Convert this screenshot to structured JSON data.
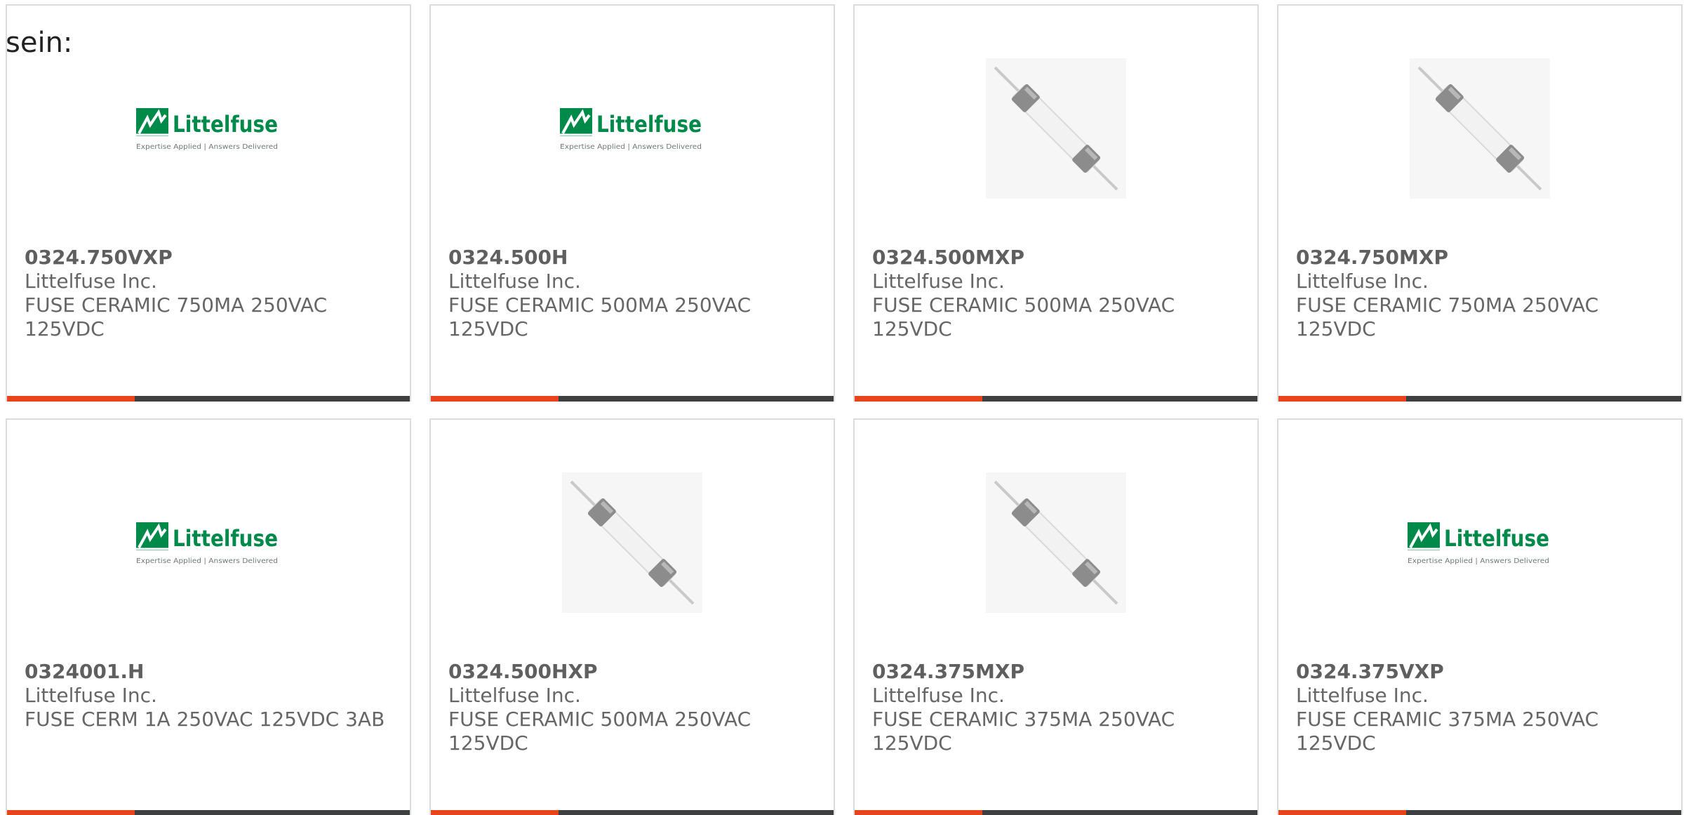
{
  "intro_text": "sein:",
  "colors": {
    "bar_accent": "#e8431a",
    "bar_rest": "#3d3f41",
    "brand_green": "#008a4a"
  },
  "logo": {
    "brand": "Littelfuse",
    "tagline": "Expertise Applied | Answers Delivered"
  },
  "products": [
    {
      "part_number": "0324.750VXP",
      "manufacturer": "Littelfuse Inc.",
      "description": "FUSE CERAMIC 750MA 250VAC 125VDC",
      "image": "littelfuse-logo"
    },
    {
      "part_number": "0324.500H",
      "manufacturer": "Littelfuse Inc.",
      "description": "FUSE CERAMIC 500MA 250VAC 125VDC",
      "image": "littelfuse-logo"
    },
    {
      "part_number": "0324.500MXP",
      "manufacturer": "Littelfuse Inc.",
      "description": "FUSE CERAMIC 500MA 250VAC 125VDC",
      "image": "fuse-photo"
    },
    {
      "part_number": "0324.750MXP",
      "manufacturer": "Littelfuse Inc.",
      "description": "FUSE CERAMIC 750MA 250VAC 125VDC",
      "image": "fuse-photo"
    },
    {
      "part_number": "0324001.H",
      "manufacturer": "Littelfuse Inc.",
      "description": "FUSE CERM 1A 250VAC 125VDC 3AB",
      "image": "littelfuse-logo"
    },
    {
      "part_number": "0324.500HXP",
      "manufacturer": "Littelfuse Inc.",
      "description": "FUSE CERAMIC 500MA 250VAC 125VDC",
      "image": "fuse-photo"
    },
    {
      "part_number": "0324.375MXP",
      "manufacturer": "Littelfuse Inc.",
      "description": "FUSE CERAMIC 375MA 250VAC 125VDC",
      "image": "fuse-photo"
    },
    {
      "part_number": "0324.375VXP",
      "manufacturer": "Littelfuse Inc.",
      "description": "FUSE CERAMIC 375MA 250VAC 125VDC",
      "image": "littelfuse-logo"
    }
  ]
}
